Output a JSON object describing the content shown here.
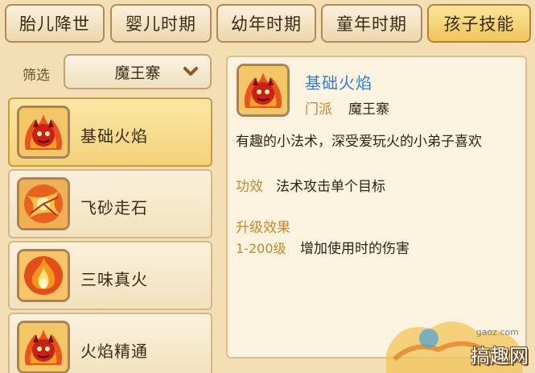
{
  "tabs": [
    {
      "label": "胎儿降世",
      "active": false
    },
    {
      "label": "婴儿时期",
      "active": false
    },
    {
      "label": "幼年时期",
      "active": false
    },
    {
      "label": "童年时期",
      "active": false
    },
    {
      "label": "孩子技能",
      "active": true
    }
  ],
  "filter": {
    "label": "筛选",
    "selected": "魔王寨"
  },
  "skills": [
    {
      "name": "基础火焰",
      "icon": "demon-fire-icon",
      "selected": true
    },
    {
      "name": "飞砂走石",
      "icon": "flying-rock-icon",
      "selected": false
    },
    {
      "name": "三味真火",
      "icon": "true-fire-icon",
      "selected": false
    },
    {
      "name": "火焰精通",
      "icon": "demon-fire-icon",
      "selected": false
    }
  ],
  "detail": {
    "title": "基础火焰",
    "sect_label": "门派",
    "sect_value": "魔王寨",
    "description": "有趣的小法术，深受爱玩火的小弟子喜欢",
    "effect_label": "功效",
    "effect_value": "法术攻击单个目标",
    "upgrade_title": "升级效果",
    "upgrade_level": "1-200级",
    "upgrade_value": "增加使用时的伤害"
  },
  "watermark": {
    "site": "gaoz.com",
    "brand": "搞趣网"
  },
  "colors": {
    "accent_title": "#2f7fd6",
    "label_gold": "#c08a2e",
    "tab_active": "#f0c55d",
    "panel_bg": "#f3dfb3"
  }
}
